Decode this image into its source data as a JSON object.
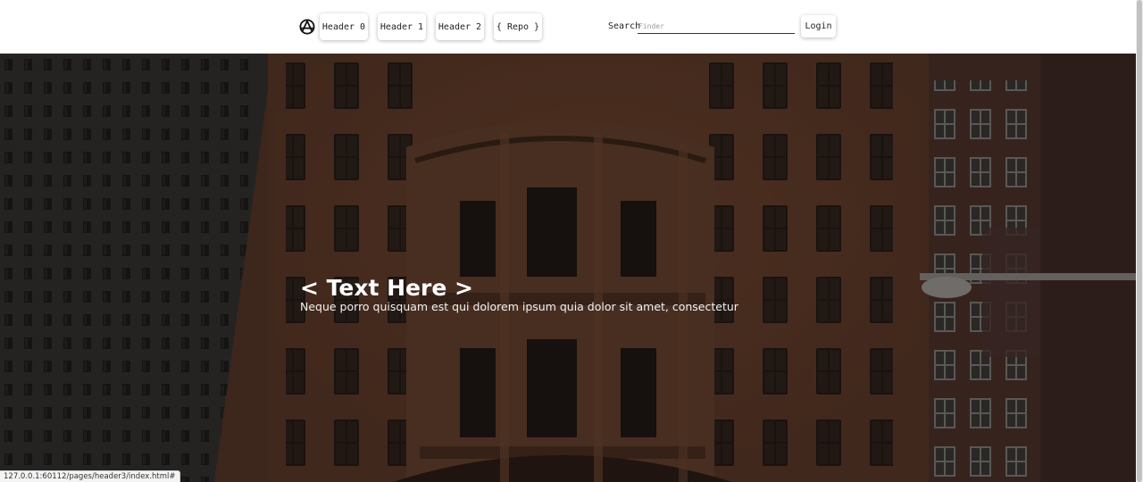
{
  "header": {
    "logo_icon": "anarchy-circle-icon",
    "nav": [
      {
        "label": "Header 0"
      },
      {
        "label": "Header 1"
      },
      {
        "label": "Header 2"
      },
      {
        "label": "{ Repo }"
      }
    ],
    "search_label": "Search",
    "search_placeholder": "Finder",
    "search_value": "",
    "login_label": "Login"
  },
  "hero": {
    "title": "< Text Here >",
    "subtitle": "Neque porro quisquam est qui dolorem ipsum quia dolor sit amet, consectetur"
  },
  "status_bar": {
    "url": "127.0.0.1:60112/pages/header3/index.html#"
  }
}
